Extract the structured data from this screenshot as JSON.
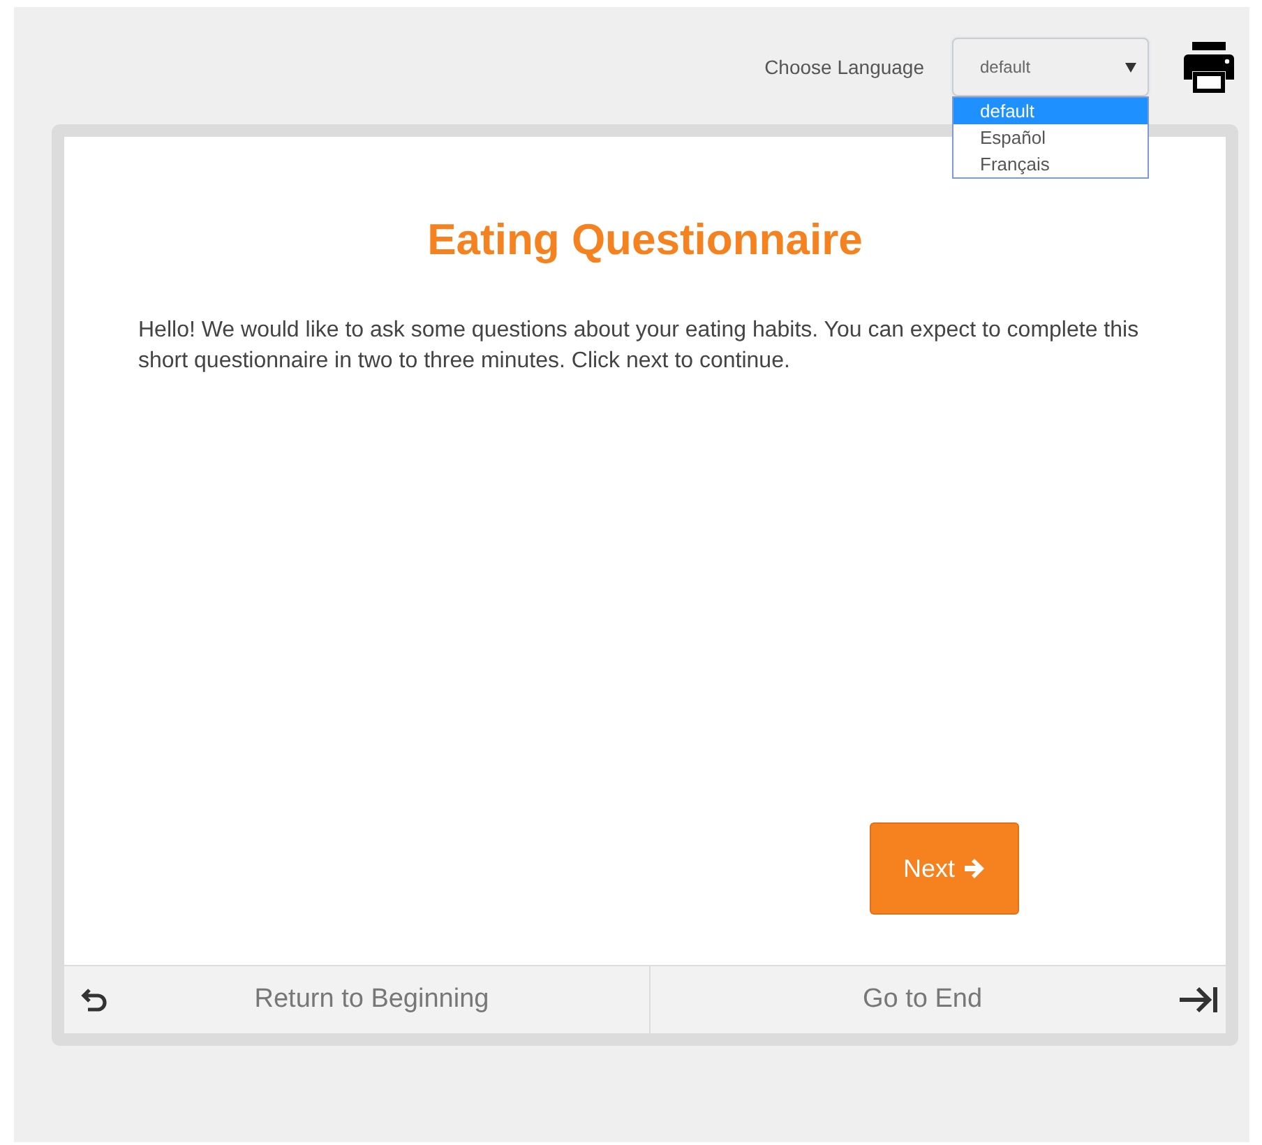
{
  "language": {
    "label": "Choose Language",
    "value": "default",
    "expanded": true,
    "options": [
      {
        "label": "default",
        "selected": true
      },
      {
        "label": "Español",
        "selected": false
      },
      {
        "label": "Français",
        "selected": false
      }
    ]
  },
  "survey": {
    "title": "Eating Questionnaire",
    "intro": "Hello! We would like to ask some questions about your eating habits. You can expect to complete this short questionnaire in two to three minutes. Click next to continue.",
    "next_button": "Next"
  },
  "footer": {
    "back": "Return to Beginning",
    "end": "Go to End"
  }
}
